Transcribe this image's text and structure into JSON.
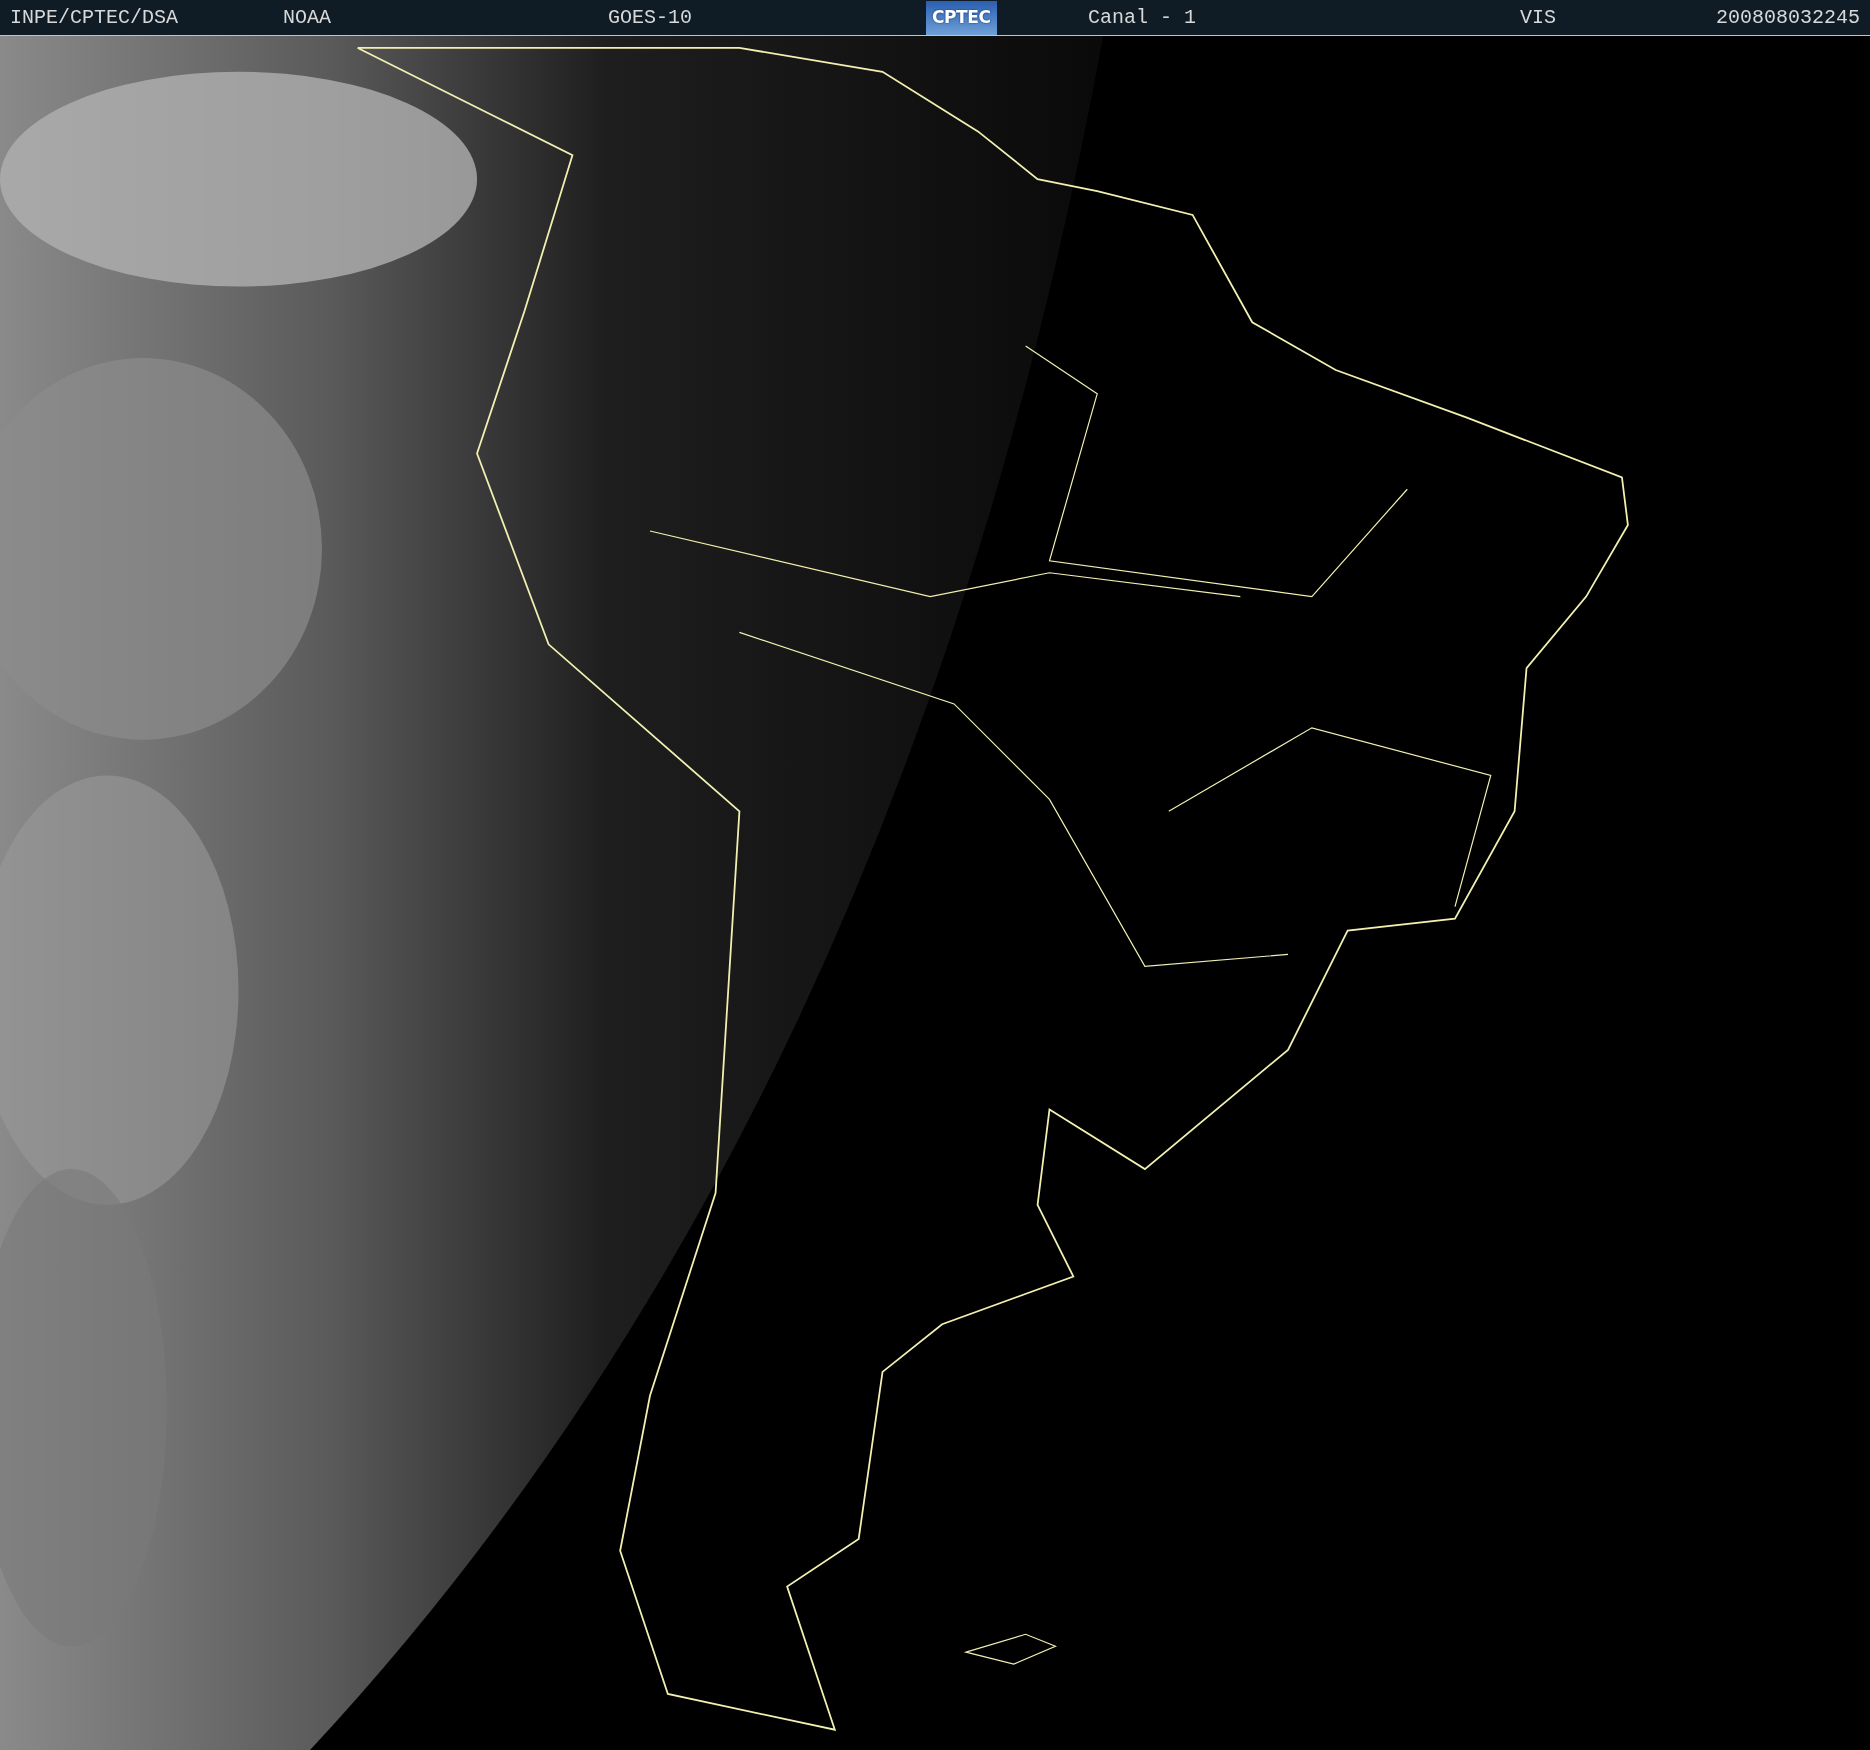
{
  "header": {
    "items": [
      {
        "kind": "text",
        "text": "INPE/CPTEC/DSA"
      },
      {
        "kind": "text",
        "text": "NOAA"
      },
      {
        "kind": "text",
        "text": "GOES-10"
      },
      {
        "kind": "logo",
        "text": "CPTEC"
      },
      {
        "kind": "text",
        "text": "Canal - 1"
      },
      {
        "kind": "text",
        "text": "VIS"
      },
      {
        "kind": "text",
        "text": "200808032245"
      }
    ]
  }
}
